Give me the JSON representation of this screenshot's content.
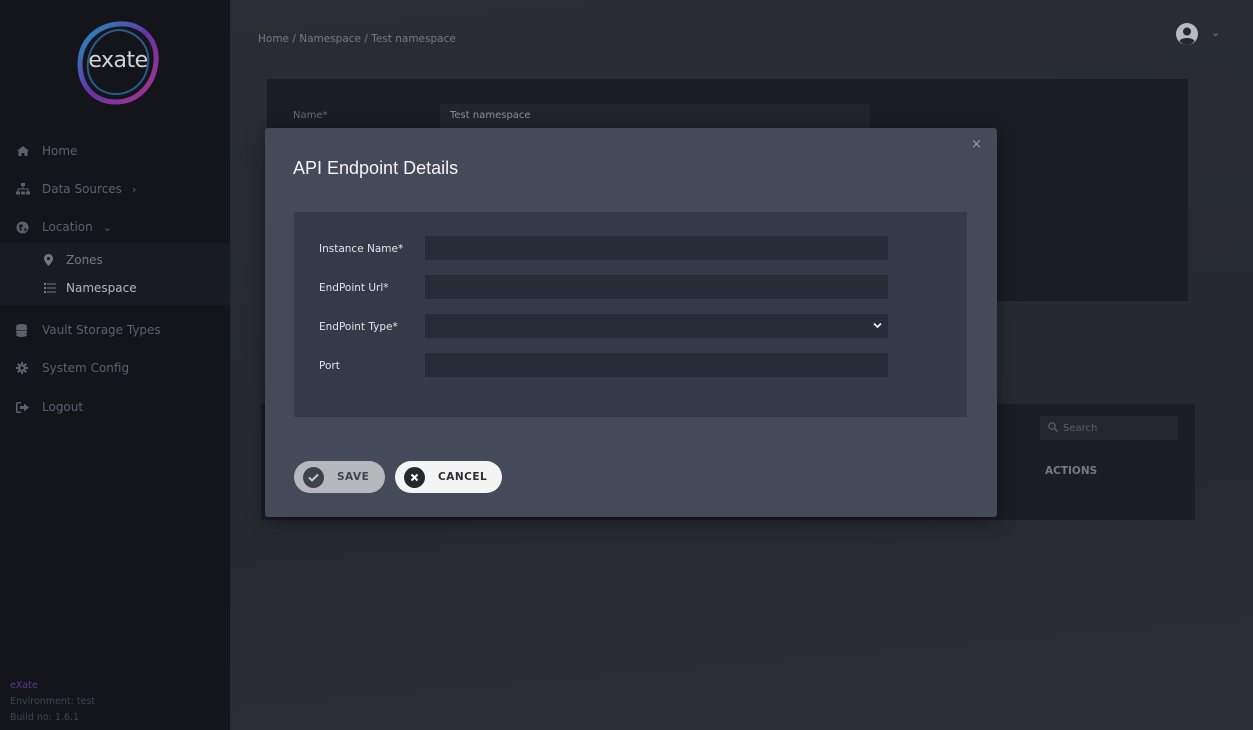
{
  "sidebar": {
    "logo_text": "exate",
    "items": [
      {
        "label": "Home",
        "icon": "home-icon"
      },
      {
        "label": "Data Sources",
        "icon": "sitemap-icon",
        "caret": "›"
      },
      {
        "label": "Location",
        "icon": "globe-icon",
        "caret": "⌄"
      },
      {
        "label": "Vault Storage Types",
        "icon": "database-icon"
      },
      {
        "label": "System Config",
        "icon": "gear-icon"
      },
      {
        "label": "Logout",
        "icon": "logout-icon"
      }
    ],
    "sub_items": [
      {
        "label": "Zones",
        "icon": "map-marker-icon"
      },
      {
        "label": "Namespace",
        "icon": "list-icon"
      }
    ],
    "footer": {
      "brand": "eXate",
      "environment": "Environment: test",
      "build": "Build no: 1.6.1"
    }
  },
  "header": {
    "breadcrumb": "Home /  Namespace /  Test namespace"
  },
  "background": {
    "name_label": "Name*",
    "name_value": "Test namespace",
    "search_placeholder": "Search",
    "actions_header": "ACTIONS"
  },
  "modal": {
    "title": "API Endpoint Details",
    "close": "×",
    "fields": [
      {
        "label": "Instance Name*",
        "value": ""
      },
      {
        "label": "EndPoint Url*",
        "value": ""
      },
      {
        "label": "EndPoint Type*",
        "value": ""
      },
      {
        "label": "Port",
        "value": ""
      }
    ],
    "save_label": "SAVE",
    "cancel_label": "CANCEL"
  },
  "colors": {
    "sidebar_bg": "#15181e",
    "modal_bg": "#434a5a",
    "form_panel_bg": "#343a47",
    "input_bg": "#272c37",
    "brand_purple": "#6b45a8"
  }
}
